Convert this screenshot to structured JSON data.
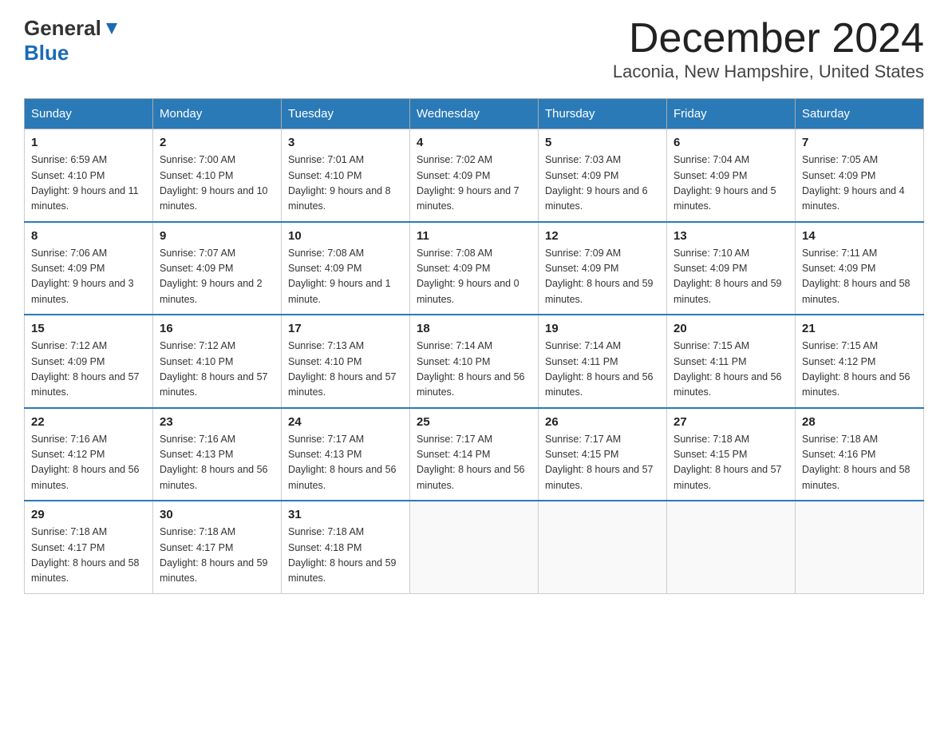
{
  "logo": {
    "general": "General",
    "blue": "Blue"
  },
  "title": "December 2024",
  "subtitle": "Laconia, New Hampshire, United States",
  "days_of_week": [
    "Sunday",
    "Monday",
    "Tuesday",
    "Wednesday",
    "Thursday",
    "Friday",
    "Saturday"
  ],
  "weeks": [
    [
      {
        "day": "1",
        "sunrise": "6:59 AM",
        "sunset": "4:10 PM",
        "daylight": "9 hours and 11 minutes."
      },
      {
        "day": "2",
        "sunrise": "7:00 AM",
        "sunset": "4:10 PM",
        "daylight": "9 hours and 10 minutes."
      },
      {
        "day": "3",
        "sunrise": "7:01 AM",
        "sunset": "4:10 PM",
        "daylight": "9 hours and 8 minutes."
      },
      {
        "day": "4",
        "sunrise": "7:02 AM",
        "sunset": "4:09 PM",
        "daylight": "9 hours and 7 minutes."
      },
      {
        "day": "5",
        "sunrise": "7:03 AM",
        "sunset": "4:09 PM",
        "daylight": "9 hours and 6 minutes."
      },
      {
        "day": "6",
        "sunrise": "7:04 AM",
        "sunset": "4:09 PM",
        "daylight": "9 hours and 5 minutes."
      },
      {
        "day": "7",
        "sunrise": "7:05 AM",
        "sunset": "4:09 PM",
        "daylight": "9 hours and 4 minutes."
      }
    ],
    [
      {
        "day": "8",
        "sunrise": "7:06 AM",
        "sunset": "4:09 PM",
        "daylight": "9 hours and 3 minutes."
      },
      {
        "day": "9",
        "sunrise": "7:07 AM",
        "sunset": "4:09 PM",
        "daylight": "9 hours and 2 minutes."
      },
      {
        "day": "10",
        "sunrise": "7:08 AM",
        "sunset": "4:09 PM",
        "daylight": "9 hours and 1 minute."
      },
      {
        "day": "11",
        "sunrise": "7:08 AM",
        "sunset": "4:09 PM",
        "daylight": "9 hours and 0 minutes."
      },
      {
        "day": "12",
        "sunrise": "7:09 AM",
        "sunset": "4:09 PM",
        "daylight": "8 hours and 59 minutes."
      },
      {
        "day": "13",
        "sunrise": "7:10 AM",
        "sunset": "4:09 PM",
        "daylight": "8 hours and 59 minutes."
      },
      {
        "day": "14",
        "sunrise": "7:11 AM",
        "sunset": "4:09 PM",
        "daylight": "8 hours and 58 minutes."
      }
    ],
    [
      {
        "day": "15",
        "sunrise": "7:12 AM",
        "sunset": "4:09 PM",
        "daylight": "8 hours and 57 minutes."
      },
      {
        "day": "16",
        "sunrise": "7:12 AM",
        "sunset": "4:10 PM",
        "daylight": "8 hours and 57 minutes."
      },
      {
        "day": "17",
        "sunrise": "7:13 AM",
        "sunset": "4:10 PM",
        "daylight": "8 hours and 57 minutes."
      },
      {
        "day": "18",
        "sunrise": "7:14 AM",
        "sunset": "4:10 PM",
        "daylight": "8 hours and 56 minutes."
      },
      {
        "day": "19",
        "sunrise": "7:14 AM",
        "sunset": "4:11 PM",
        "daylight": "8 hours and 56 minutes."
      },
      {
        "day": "20",
        "sunrise": "7:15 AM",
        "sunset": "4:11 PM",
        "daylight": "8 hours and 56 minutes."
      },
      {
        "day": "21",
        "sunrise": "7:15 AM",
        "sunset": "4:12 PM",
        "daylight": "8 hours and 56 minutes."
      }
    ],
    [
      {
        "day": "22",
        "sunrise": "7:16 AM",
        "sunset": "4:12 PM",
        "daylight": "8 hours and 56 minutes."
      },
      {
        "day": "23",
        "sunrise": "7:16 AM",
        "sunset": "4:13 PM",
        "daylight": "8 hours and 56 minutes."
      },
      {
        "day": "24",
        "sunrise": "7:17 AM",
        "sunset": "4:13 PM",
        "daylight": "8 hours and 56 minutes."
      },
      {
        "day": "25",
        "sunrise": "7:17 AM",
        "sunset": "4:14 PM",
        "daylight": "8 hours and 56 minutes."
      },
      {
        "day": "26",
        "sunrise": "7:17 AM",
        "sunset": "4:15 PM",
        "daylight": "8 hours and 57 minutes."
      },
      {
        "day": "27",
        "sunrise": "7:18 AM",
        "sunset": "4:15 PM",
        "daylight": "8 hours and 57 minutes."
      },
      {
        "day": "28",
        "sunrise": "7:18 AM",
        "sunset": "4:16 PM",
        "daylight": "8 hours and 58 minutes."
      }
    ],
    [
      {
        "day": "29",
        "sunrise": "7:18 AM",
        "sunset": "4:17 PM",
        "daylight": "8 hours and 58 minutes."
      },
      {
        "day": "30",
        "sunrise": "7:18 AM",
        "sunset": "4:17 PM",
        "daylight": "8 hours and 59 minutes."
      },
      {
        "day": "31",
        "sunrise": "7:18 AM",
        "sunset": "4:18 PM",
        "daylight": "8 hours and 59 minutes."
      },
      null,
      null,
      null,
      null
    ]
  ],
  "labels": {
    "sunrise": "Sunrise:",
    "sunset": "Sunset:",
    "daylight": "Daylight:"
  }
}
